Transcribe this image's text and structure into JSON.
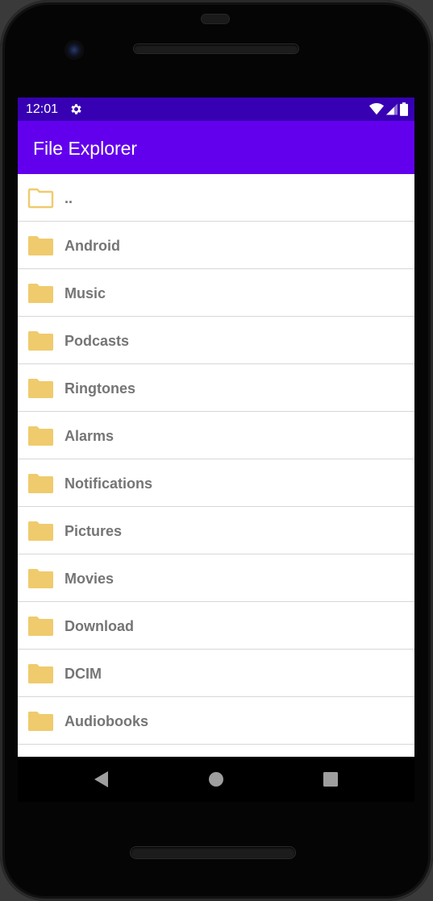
{
  "status_bar": {
    "time": "12:01",
    "icons": [
      "settings-gear-icon",
      "wifi-icon",
      "cell-signal-icon",
      "battery-icon"
    ]
  },
  "app_bar": {
    "title": "File Explorer"
  },
  "colors": {
    "status_bar": "#3700b3",
    "app_bar": "#6200ee",
    "folder": "#efcb6d",
    "label": "#757575"
  },
  "file_list": {
    "items": [
      {
        "label": "..",
        "icon": "folder-outline-icon"
      },
      {
        "label": "Android",
        "icon": "folder-icon"
      },
      {
        "label": "Music",
        "icon": "folder-icon"
      },
      {
        "label": "Podcasts",
        "icon": "folder-icon"
      },
      {
        "label": "Ringtones",
        "icon": "folder-icon"
      },
      {
        "label": "Alarms",
        "icon": "folder-icon"
      },
      {
        "label": "Notifications",
        "icon": "folder-icon"
      },
      {
        "label": "Pictures",
        "icon": "folder-icon"
      },
      {
        "label": "Movies",
        "icon": "folder-icon"
      },
      {
        "label": "Download",
        "icon": "folder-icon"
      },
      {
        "label": "DCIM",
        "icon": "folder-icon"
      },
      {
        "label": "Audiobooks",
        "icon": "folder-icon"
      },
      {
        "label": "",
        "icon": "folder-icon"
      }
    ]
  },
  "nav_bar": {
    "buttons": [
      "back-icon",
      "home-icon",
      "recents-icon"
    ]
  }
}
